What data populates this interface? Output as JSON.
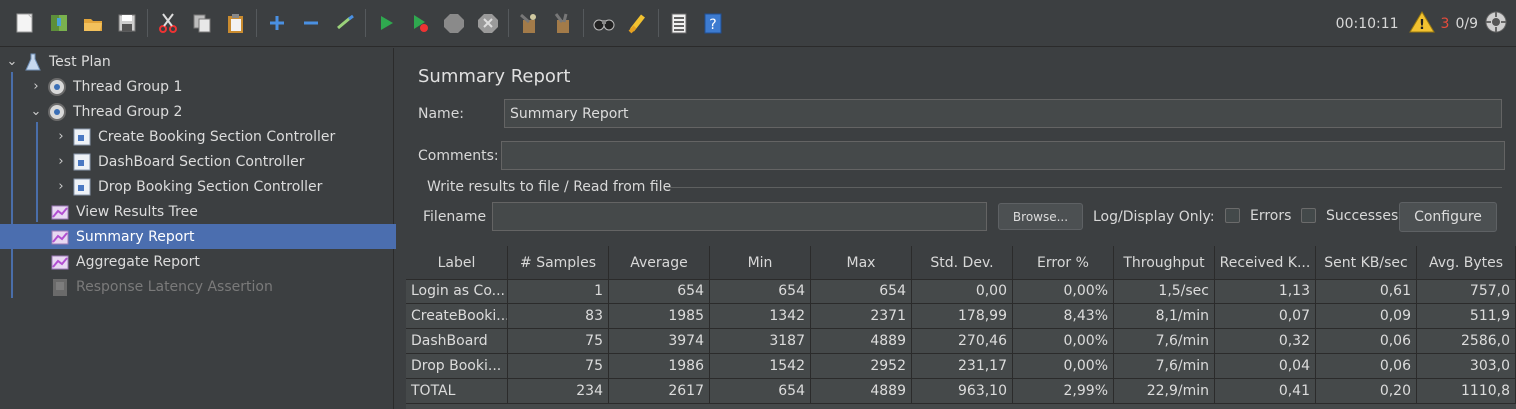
{
  "toolbar": {
    "icons": [
      "new-icon",
      "templates-icon",
      "open-icon",
      "save-icon",
      "cut-icon",
      "copy-icon",
      "paste-icon",
      "expand-icon",
      "collapse-icon",
      "toggle-icon",
      "start-icon",
      "start-no-pauses-icon",
      "stop-icon",
      "shutdown-icon",
      "clear-icon",
      "clear-all-icon",
      "search-icon",
      "reset-search-icon",
      "function-helper-icon",
      "help-icon"
    ],
    "timer": "00:10:11",
    "warning_count": "3",
    "threads": "0/9",
    "colors": {
      "start": "#2fa84f",
      "warn": "#e74c3c",
      "accent": "#4b6eaf"
    }
  },
  "tree": {
    "items": [
      {
        "label": "Test Plan",
        "icon": "test-plan-icon",
        "expanded": true
      },
      {
        "label": "Thread Group 1",
        "icon": "thread-group-icon",
        "expanded": false
      },
      {
        "label": "Thread Group 2",
        "icon": "thread-group-icon",
        "expanded": true
      },
      {
        "label": "Create Booking Section Controller",
        "icon": "controller-icon",
        "expanded": false
      },
      {
        "label": "DashBoard Section Controller",
        "icon": "controller-icon",
        "expanded": false
      },
      {
        "label": "Drop Booking Section Controller",
        "icon": "controller-icon",
        "expanded": false
      },
      {
        "label": "View Results Tree",
        "icon": "listener-icon"
      },
      {
        "label": "Summary Report",
        "icon": "listener-icon",
        "selected": true
      },
      {
        "label": "Aggregate Report",
        "icon": "listener-icon"
      },
      {
        "label": "Response Latency Assertion",
        "icon": "assertion-icon",
        "disabled": true
      }
    ]
  },
  "panel": {
    "title": "Summary Report",
    "name_label": "Name:",
    "name_value": "Summary Report",
    "comments_label": "Comments:",
    "comments_value": "",
    "group_title": "Write results to file / Read from file",
    "filename_label": "Filename",
    "filename_value": "",
    "browse_label": "Browse...",
    "log_label": "Log/Display Only:",
    "errors_label": "Errors",
    "successes_label": "Successes",
    "configure_label": "Configure"
  },
  "table": {
    "columns": [
      "Label",
      "# Samples",
      "Average",
      "Min",
      "Max",
      "Std. Dev.",
      "Error %",
      "Throughput",
      "Received K...",
      "Sent KB/sec",
      "Avg. Bytes"
    ],
    "rows": [
      [
        "Login as Co...",
        "1",
        "654",
        "654",
        "654",
        "0,00",
        "0,00%",
        "1,5/sec",
        "1,13",
        "0,61",
        "757,0"
      ],
      [
        "CreateBooki...",
        "83",
        "1985",
        "1342",
        "2371",
        "178,99",
        "8,43%",
        "8,1/min",
        "0,07",
        "0,09",
        "511,9"
      ],
      [
        "DashBoard",
        "75",
        "3974",
        "3187",
        "4889",
        "270,46",
        "0,00%",
        "7,6/min",
        "0,32",
        "0,06",
        "2586,0"
      ],
      [
        "Drop Booki...",
        "75",
        "1986",
        "1542",
        "2952",
        "231,17",
        "0,00%",
        "7,6/min",
        "0,04",
        "0,06",
        "303,0"
      ],
      [
        "TOTAL",
        "234",
        "2617",
        "654",
        "4889",
        "963,10",
        "2,99%",
        "22,9/min",
        "0,41",
        "0,20",
        "1110,8"
      ]
    ]
  }
}
